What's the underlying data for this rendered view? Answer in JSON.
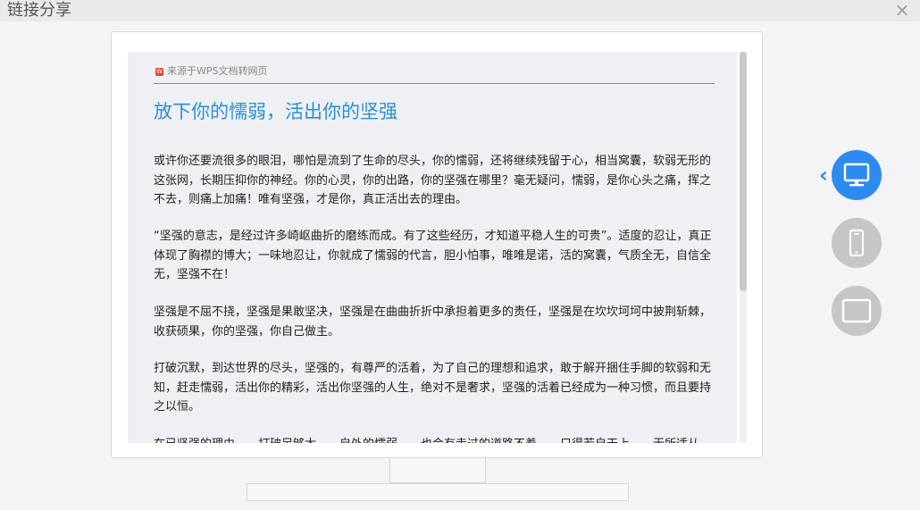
{
  "window": {
    "title": "链接分享",
    "close_glyph": "×"
  },
  "document": {
    "source_label": "来源于WPS文档转网页",
    "source_icon": "W",
    "heading": "放下你的懦弱，活出你的坚强",
    "paragraphs": [
      "或许你还要流很多的眼泪，哪怕是流到了生命的尽头，你的懦弱，还将继续残留于心，相当窝囊，软弱无形的这张网，长期压抑你的神经。你的心灵，你的出路，你的坚强在哪里？毫无疑问，懦弱，是你心头之痛，挥之不去，则痛上加痛！唯有坚强，才是你，真正活出去的理由。",
      "“坚强的意志，是经过许多崎岖曲折的磨练而成。有了这些经历，才知道平稳人生的可贵”。适度的忍让，真正体现了胸襟的博大；一味地忍让，你就成了懦弱的代言，胆小怕事，唯唯是诺，活的窝囊，气质全无，自信全无，坚强不在！",
      "坚强是不屈不挠，坚强是果敢坚决，坚强是在曲曲折折中承担着更多的责任，坚强是在坎坎坷坷中披荆斩棘，收获硕果，你的坚强，你自己做主。",
      "打破沉默，到达世界的尽头，坚强的，有尊严的活着，为了自己的理想和追求，敢于解开捆住手脚的软弱和无知，赶走懦弱，活出你的精彩，活出你坚强的人生，绝对不是奢求，坚强的活着已经成为一种习惯，而且要持之以恒。",
      "在已坚强的理由……打破足够大……自外的懦弱……也会有走过的道路不着……只得若自天上……无所适从"
    ]
  },
  "preview_modes": {
    "collapse_glyph": "‹",
    "items": [
      {
        "icon": "desktop-icon",
        "selected": true
      },
      {
        "icon": "phone-icon",
        "selected": false
      },
      {
        "icon": "tablet-icon",
        "selected": false
      }
    ]
  },
  "colors": {
    "accent": "#2d8bf0",
    "heading": "#2b8fd6",
    "inactive_button": "#c6c6c8"
  }
}
